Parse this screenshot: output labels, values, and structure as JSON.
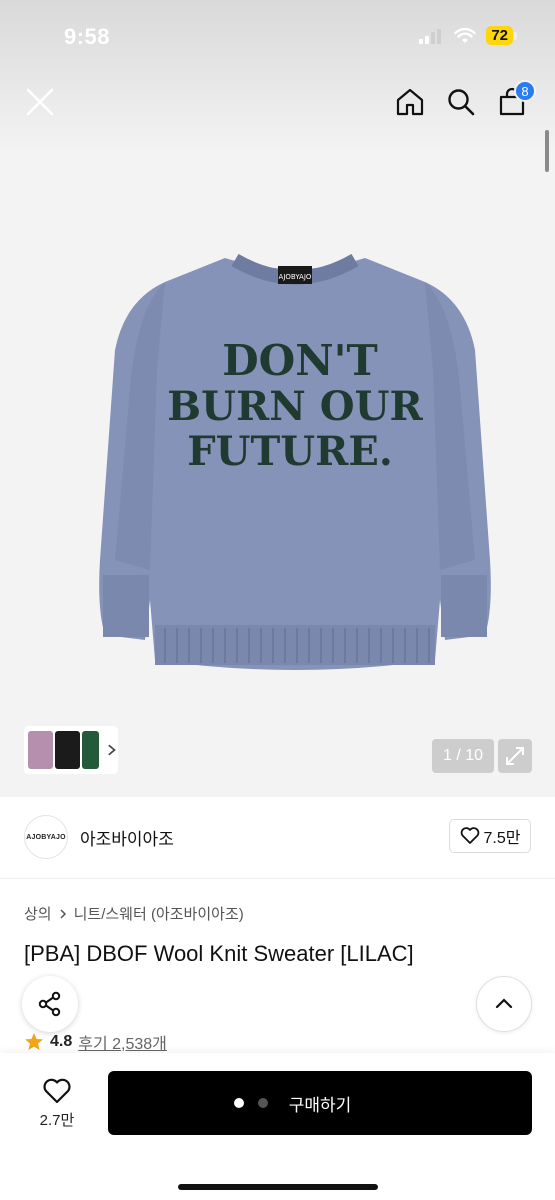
{
  "status_bar": {
    "time": "9:58",
    "battery": "72"
  },
  "nav": {
    "cart_count": "8"
  },
  "gallery": {
    "counter": "1 / 10"
  },
  "brand": {
    "logo_text": "AJOBYAJO",
    "name": "아조바이아조",
    "likes": "7.5만"
  },
  "breadcrumb": {
    "level1": "상의",
    "level2": "니트/스웨터 (아조바이아조)"
  },
  "product": {
    "title": "[PBA] DBOF Wool Knit Sweater [LILAC]"
  },
  "rating": {
    "score": "4.8",
    "reviews": "후기 2,538개"
  },
  "bottom_bar": {
    "wish_count": "2.7만",
    "buy_label": "구매하기"
  },
  "colors": {
    "sweater": "#8693b8",
    "graphic": "#1f3a30",
    "badge": "#2a7df0",
    "buy_button": "#000000",
    "star": "#f2a41a"
  }
}
